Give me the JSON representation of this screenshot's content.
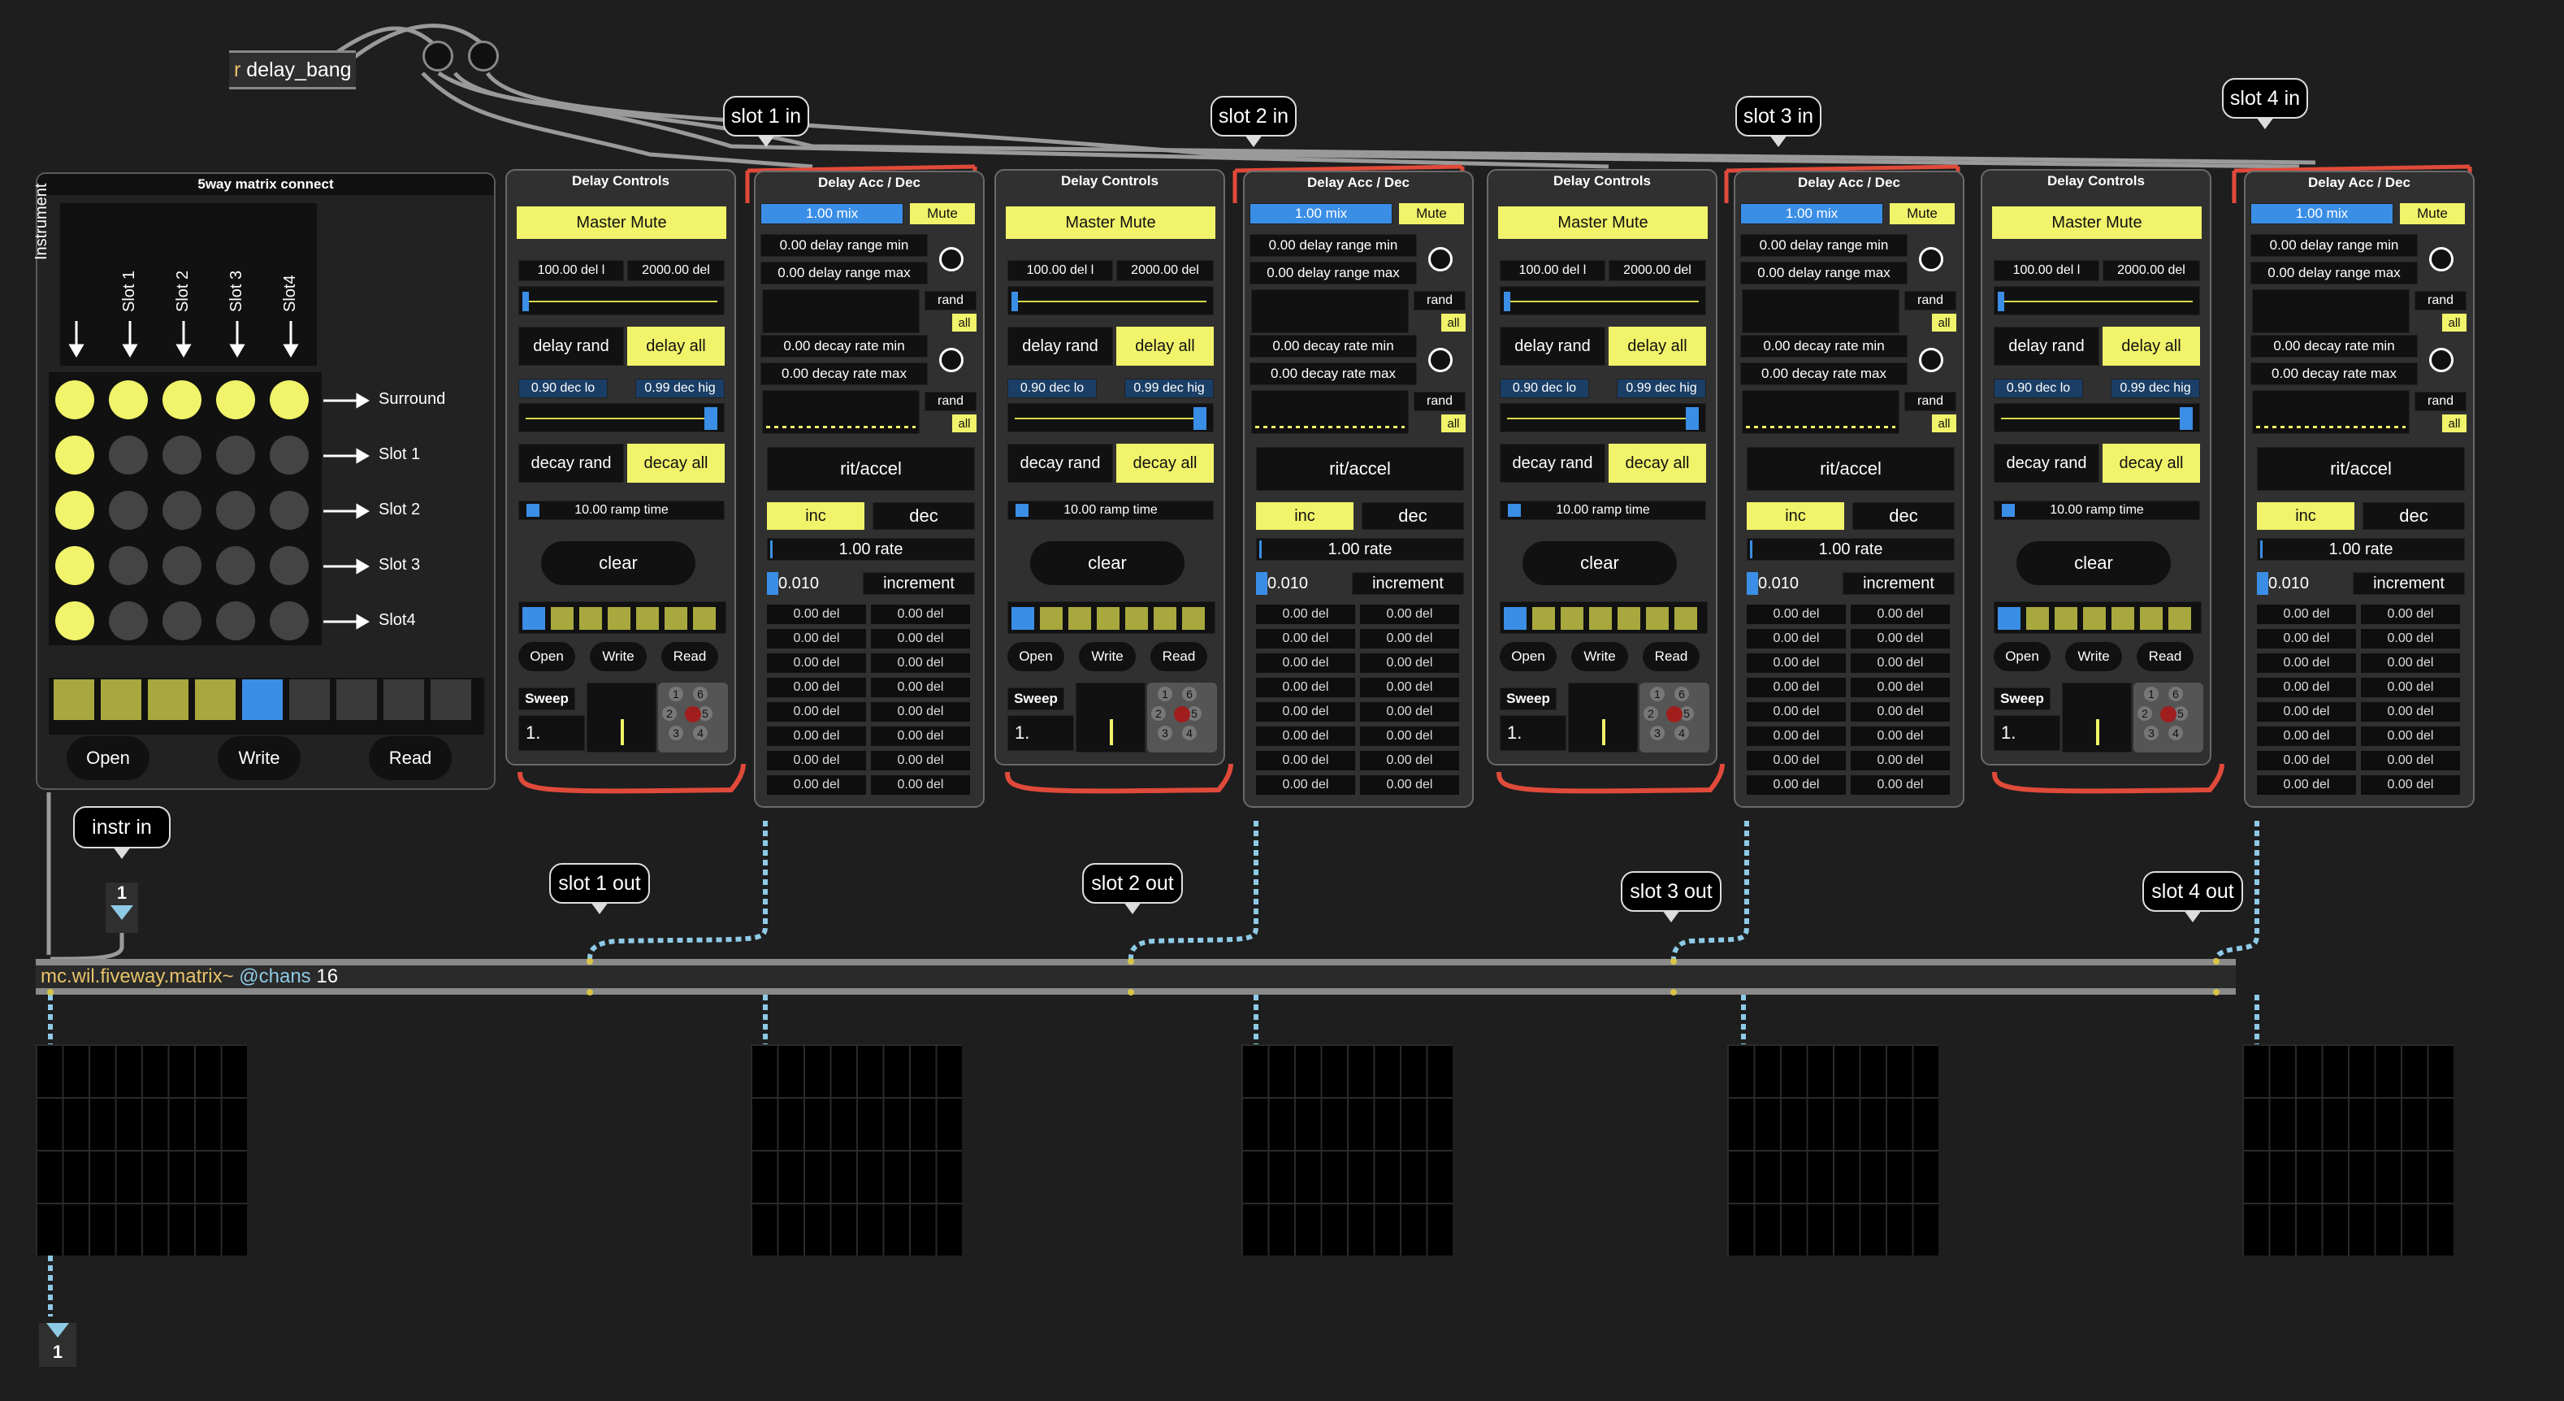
{
  "receive": {
    "keyword": "r",
    "name": "delay_bang"
  },
  "matrix_panel": {
    "title": "5way matrix connect",
    "columns": [
      "Instrument",
      "Slot 1",
      "Slot 2",
      "Slot 3",
      "Slot4"
    ],
    "rows": [
      "Surround",
      "Slot 1",
      "Slot 2",
      "Slot 3",
      "Slot4"
    ],
    "active_grid": [
      [
        1,
        1,
        1,
        1,
        1
      ],
      [
        1,
        0,
        0,
        0,
        0
      ],
      [
        1,
        0,
        0,
        0,
        0
      ],
      [
        1,
        0,
        0,
        0,
        0
      ],
      [
        1,
        0,
        0,
        0,
        0
      ]
    ],
    "presets": [
      "filled",
      "filled",
      "filled",
      "filled",
      "selected",
      "empty",
      "empty",
      "empty",
      "empty"
    ],
    "buttons": {
      "open": "Open",
      "write": "Write",
      "read": "Read"
    }
  },
  "delay_controls": {
    "title": "Delay Controls",
    "master_mute": "Master Mute",
    "delay_low": "100.00 del l",
    "delay_high": "2000.00 del",
    "delay_rand": "delay rand",
    "delay_all": "delay all",
    "dec_low": "0.90 dec lo",
    "dec_high": "0.99 dec hig",
    "decay_rand": "decay rand",
    "decay_all": "decay all",
    "ramp_time": "10.00 ramp time",
    "clear": "clear",
    "open": "Open",
    "write": "Write",
    "read": "Read",
    "sweep": "Sweep",
    "sweep_value": "1.",
    "dice": [
      "1",
      "6",
      "2",
      "5",
      "3",
      "4"
    ]
  },
  "delay_acc": {
    "title": "Delay Acc / Dec",
    "mix": "1.00 mix",
    "mute": "Mute",
    "delay_range_min": "0.00 delay range min",
    "delay_range_max": "0.00 delay range max",
    "rand": "rand",
    "all": "all",
    "decay_rate_min": "0.00 decay rate min",
    "decay_rate_max": "0.00 decay rate max",
    "rit_accel": "rit/accel",
    "inc": "inc",
    "dec": "dec",
    "rate": "1.00 rate",
    "increment_value": "0.010",
    "increment_label": "increment",
    "del_cell": "0.00 del"
  },
  "slots": [
    {
      "in_label": "slot 1 in",
      "out_label": "slot 1 out"
    },
    {
      "in_label": "slot 2 in",
      "out_label": "slot 2 out"
    },
    {
      "in_label": "slot 3 in",
      "out_label": "slot 3 out"
    },
    {
      "in_label": "slot 4 in",
      "out_label": "slot 4 out"
    }
  ],
  "instr_in": {
    "label": "instr in",
    "inlet_number": "1"
  },
  "matrix_object": {
    "name": "mc.wil.fiveway.matrix~",
    "attr": "@chans",
    "value": "16"
  },
  "outlet": {
    "number": "1"
  },
  "colors": {
    "background": "#1e1e1e",
    "yellow": "#f1f36a",
    "blue": "#3a8ee6",
    "red": "#e04a3a",
    "patchcord_mc": "#8ecae6"
  }
}
